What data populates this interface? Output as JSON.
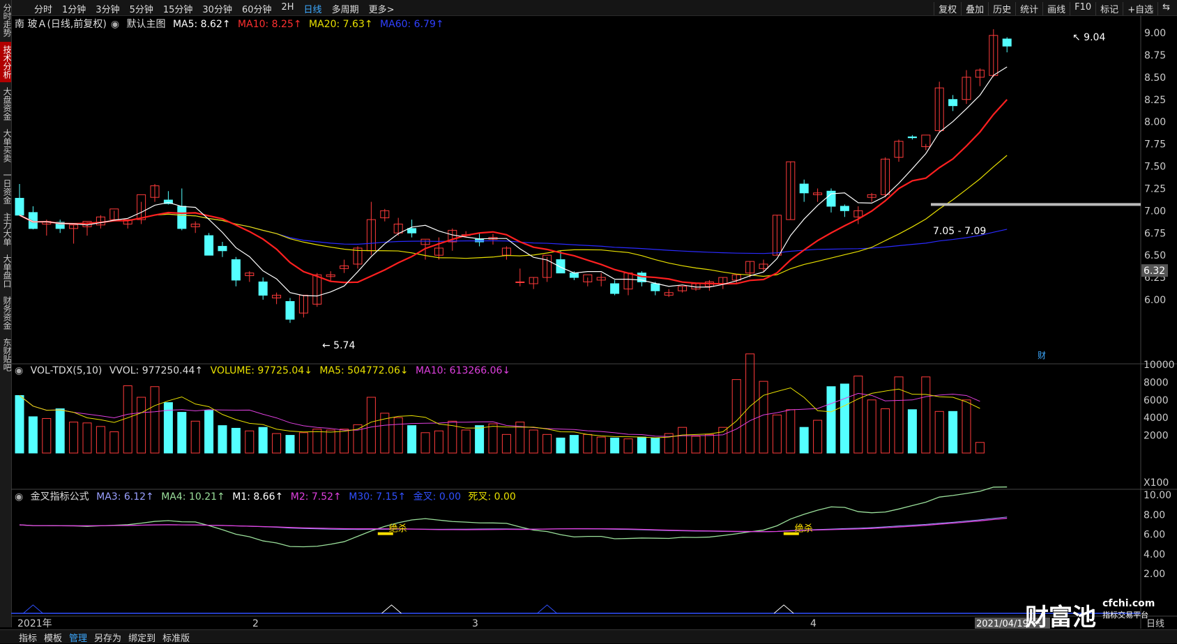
{
  "toolbar": {
    "left": [
      "分时",
      "1分钟",
      "3分钟",
      "5分钟",
      "15分钟",
      "30分钟",
      "60分钟",
      "2H",
      "日线",
      "多周期",
      "更多>"
    ],
    "active_index": 8,
    "right": [
      "复权",
      "叠加",
      "历史",
      "统计",
      "画线",
      "F10",
      "标记",
      "+自选",
      "⇆"
    ]
  },
  "sidebar": [
    "分时走势",
    "技术分析",
    "大盘资金",
    "大单买卖",
    "一日资金",
    "主力大单",
    "大单盘口",
    "财务资金",
    "东财贴吧"
  ],
  "sidebar_active": 1,
  "main": {
    "stock": "南 玻Ａ(日线,前复权)",
    "template": "默认主图",
    "ma5": "MA5: 8.62↑",
    "ma10": "MA10: 8.25↑",
    "ma20": "MA20: 7.63↑",
    "ma60": "MA60: 6.79↑",
    "high_label": "9.04",
    "low_label": "5.74",
    "range_label": "7.05 - 7.09",
    "price_ticks": [
      "9.00",
      "8.75",
      "8.50",
      "8.25",
      "8.00",
      "7.75",
      "7.50",
      "7.25",
      "7.00",
      "6.75",
      "6.50",
      "6.25",
      "6.00"
    ],
    "current_price": "6.32",
    "cai_marker": "财"
  },
  "vol": {
    "name": "VOL-TDX(5,10)",
    "vvol": "VVOL: 977250.44↑",
    "volume": "VOLUME: 97725.04↓",
    "ma5": "MA5: 504772.06↓",
    "ma10": "MA10: 613266.06↓",
    "ticks": [
      "10000",
      "8000",
      "6000",
      "4000",
      "2000"
    ],
    "unit": "X100"
  },
  "indicator": {
    "name": "金叉指标公式",
    "ma3": "MA3: 6.12↑",
    "ma4": "MA4: 10.21↑",
    "m1": "M1: 8.66↑",
    "m2": "M2: 7.52↑",
    "m30": "M30: 7.15↑",
    "jincha": "金叉: 0.00",
    "sicha": "死叉: 0.00",
    "ticks": [
      "10.00",
      "8.00",
      "6.00",
      "4.00",
      "2.00"
    ],
    "kill_label": "绝杀"
  },
  "xaxis": {
    "labels": [
      "2021年",
      "2",
      "3",
      "4"
    ],
    "date": "2021/04/19/一",
    "period": "日线"
  },
  "bottom_tabs": [
    "指标",
    "模板",
    "管理",
    "另存为",
    "绑定到",
    "标准版"
  ],
  "bottom_active": 2,
  "watermark": {
    "brand": "财富池",
    "site": "cfchi.com",
    "slogan": "指标交易平台"
  },
  "colors": {
    "up": "#ff3b3b",
    "down": "#54ffff",
    "ma5": "#ffffff",
    "ma10": "#ff2020",
    "ma20": "#e8e000",
    "ma60": "#2a2aff"
  },
  "chart_data": {
    "type": "candlestick",
    "ohlc": [
      [
        7.14,
        7.3,
        6.95,
        6.95
      ],
      [
        6.98,
        7.05,
        6.79,
        6.8
      ],
      [
        6.85,
        6.9,
        6.72,
        6.88
      ],
      [
        6.87,
        6.9,
        6.75,
        6.8
      ],
      [
        6.8,
        6.84,
        6.63,
        6.84
      ],
      [
        6.82,
        6.87,
        6.72,
        6.88
      ],
      [
        6.84,
        6.95,
        6.8,
        6.93
      ],
      [
        6.9,
        7.0,
        6.88,
        7.02
      ],
      [
        6.85,
        6.9,
        6.8,
        6.9
      ],
      [
        6.9,
        7.1,
        6.85,
        7.18
      ],
      [
        7.15,
        7.3,
        7.1,
        7.28
      ],
      [
        7.12,
        7.22,
        7.07,
        7.08
      ],
      [
        7.05,
        7.25,
        6.78,
        6.8
      ],
      [
        6.82,
        6.88,
        6.75,
        6.85
      ],
      [
        6.72,
        6.75,
        6.5,
        6.5
      ],
      [
        6.6,
        6.65,
        6.48,
        6.55
      ],
      [
        6.45,
        6.48,
        6.15,
        6.22
      ],
      [
        6.27,
        6.32,
        6.2,
        6.3
      ],
      [
        6.2,
        6.25,
        6.0,
        6.05
      ],
      [
        6.02,
        6.08,
        5.95,
        6.05
      ],
      [
        5.98,
        6.02,
        5.74,
        5.78
      ],
      [
        5.85,
        6.05,
        5.8,
        6.05
      ],
      [
        5.95,
        6.3,
        5.92,
        6.28
      ],
      [
        6.26,
        6.32,
        6.2,
        6.28
      ],
      [
        6.35,
        6.45,
        6.3,
        6.38
      ],
      [
        6.4,
        6.6,
        6.35,
        6.58
      ],
      [
        6.55,
        7.1,
        6.5,
        6.9
      ],
      [
        6.92,
        7.02,
        6.88,
        7.0
      ],
      [
        6.75,
        6.92,
        6.72,
        6.85
      ],
      [
        6.8,
        6.9,
        6.7,
        6.75
      ],
      [
        6.62,
        6.67,
        6.45,
        6.68
      ],
      [
        6.5,
        6.7,
        6.45,
        6.58
      ],
      [
        6.65,
        6.8,
        6.55,
        6.78
      ],
      [
        6.73,
        6.77,
        6.7,
        6.73
      ],
      [
        6.68,
        6.75,
        6.6,
        6.65
      ],
      [
        6.68,
        6.74,
        6.62,
        6.7
      ],
      [
        6.5,
        6.6,
        6.45,
        6.58
      ],
      [
        6.2,
        6.35,
        6.15,
        6.2
      ],
      [
        6.18,
        6.25,
        6.12,
        6.25
      ],
      [
        6.25,
        6.48,
        6.2,
        6.5
      ],
      [
        6.45,
        6.55,
        6.3,
        6.3
      ],
      [
        6.3,
        6.32,
        6.22,
        6.25
      ],
      [
        6.2,
        6.25,
        6.15,
        6.28
      ],
      [
        6.22,
        6.3,
        6.15,
        6.25
      ],
      [
        6.18,
        6.22,
        6.05,
        6.07
      ],
      [
        6.12,
        6.3,
        6.05,
        6.3
      ],
      [
        6.3,
        6.32,
        6.15,
        6.2
      ],
      [
        6.18,
        6.2,
        6.05,
        6.1
      ],
      [
        6.05,
        6.12,
        6.03,
        6.08
      ],
      [
        6.1,
        6.15,
        6.08,
        6.15
      ],
      [
        6.12,
        6.18,
        6.1,
        6.18
      ],
      [
        6.15,
        6.22,
        6.1,
        6.2
      ],
      [
        6.18,
        6.25,
        6.12,
        6.25
      ],
      [
        6.22,
        6.28,
        6.18,
        6.28
      ],
      [
        6.3,
        6.43,
        6.25,
        6.43
      ],
      [
        6.35,
        6.45,
        6.32,
        6.4
      ],
      [
        6.5,
        6.95,
        6.5,
        6.95
      ],
      [
        6.9,
        7.55,
        6.9,
        7.55
      ],
      [
        7.3,
        7.35,
        7.1,
        7.2
      ],
      [
        7.18,
        7.25,
        7.1,
        7.2
      ],
      [
        7.22,
        7.25,
        6.98,
        7.05
      ],
      [
        7.05,
        7.07,
        6.93,
        7.0
      ],
      [
        6.93,
        7.05,
        6.85,
        7.0
      ],
      [
        7.15,
        7.2,
        7.1,
        7.18
      ],
      [
        7.18,
        7.6,
        7.15,
        7.58
      ],
      [
        7.6,
        7.8,
        7.55,
        7.78
      ],
      [
        7.83,
        7.85,
        7.8,
        7.82
      ],
      [
        7.72,
        7.75,
        7.68,
        7.85
      ],
      [
        7.9,
        8.45,
        7.88,
        8.38
      ],
      [
        8.25,
        8.3,
        8.12,
        8.18
      ],
      [
        8.25,
        8.58,
        8.2,
        8.5
      ],
      [
        8.5,
        8.6,
        8.4,
        8.58
      ],
      [
        8.52,
        9.04,
        8.5,
        8.97
      ],
      [
        8.93,
        8.95,
        8.78,
        8.85
      ]
    ],
    "volume": [
      65,
      41,
      39,
      50,
      35,
      34,
      30,
      24,
      76,
      63,
      75,
      57,
      46,
      36,
      48,
      31,
      28,
      25,
      29,
      22,
      20,
      23,
      27,
      26,
      27,
      32,
      63,
      45,
      40,
      31,
      23,
      25,
      36,
      26,
      31,
      33,
      21,
      35,
      26,
      21,
      17,
      20,
      21,
      18,
      17,
      16,
      18,
      17,
      22,
      29,
      19,
      21,
      29,
      83,
      112,
      81,
      43,
      49,
      29,
      37,
      75,
      78,
      87,
      60,
      50,
      86,
      49,
      86,
      47,
      47,
      60,
      12
    ],
    "ylim": [
      5.74,
      9.04
    ]
  }
}
